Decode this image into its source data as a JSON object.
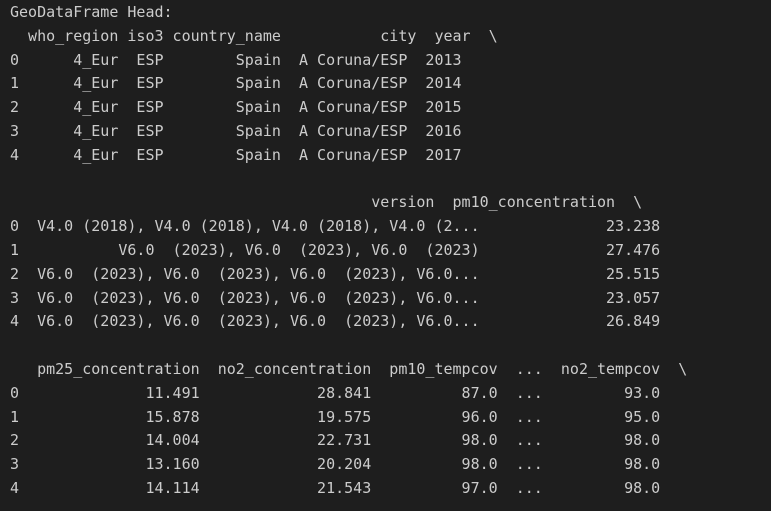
{
  "output": {
    "lines": [
      "GeoDataFrame Head:",
      "  who_region iso3 country_name           city  year  \\",
      "0      4_Eur  ESP        Spain  A Coruna/ESP  2013",
      "1      4_Eur  ESP        Spain  A Coruna/ESP  2014",
      "2      4_Eur  ESP        Spain  A Coruna/ESP  2015",
      "3      4_Eur  ESP        Spain  A Coruna/ESP  2016",
      "4      4_Eur  ESP        Spain  A Coruna/ESP  2017",
      "",
      "                                        version  pm10_concentration  \\",
      "0  V4.0 (2018), V4.0 (2018), V4.0 (2018), V4.0 (2...              23.238",
      "1           V6.0  (2023), V6.0  (2023), V6.0  (2023)              27.476",
      "2  V6.0  (2023), V6.0  (2023), V6.0  (2023), V6.0...              25.515",
      "3  V6.0  (2023), V6.0  (2023), V6.0  (2023), V6.0...              23.057",
      "4  V6.0  (2023), V6.0  (2023), V6.0  (2023), V6.0...              26.849",
      "",
      "   pm25_concentration  no2_concentration  pm10_tempcov  ...  no2_tempcov  \\",
      "0              11.491             28.841          87.0  ...         93.0",
      "1              15.878             19.575          96.0  ...         95.0",
      "2              14.004             22.731          98.0  ...         98.0",
      "3              13.160             20.204          98.0  ...         98.0",
      "4              14.114             21.543          97.0  ...         98.0"
    ]
  }
}
